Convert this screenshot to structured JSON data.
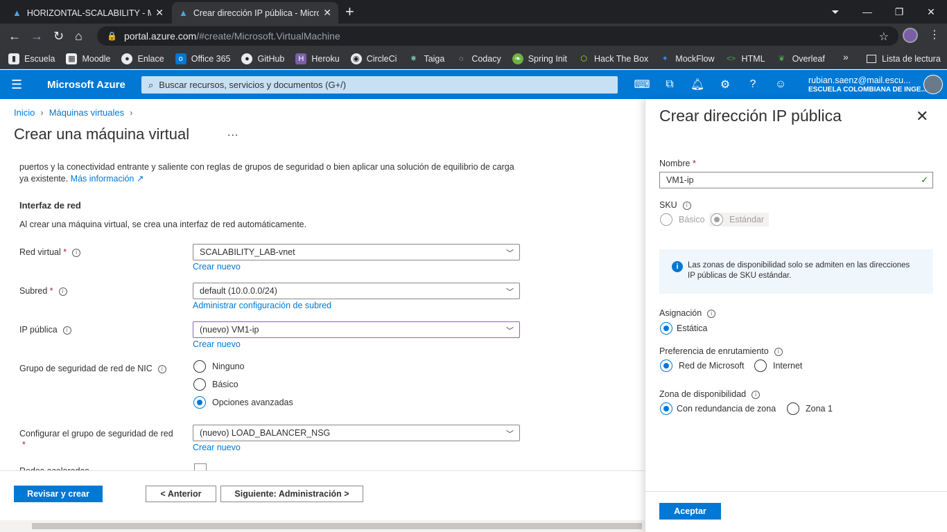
{
  "browser": {
    "tabs": [
      {
        "title": "HORIZONTAL-SCALABILITY - Mic",
        "active": false
      },
      {
        "title": "Crear dirección IP pública - Micro",
        "active": true
      }
    ],
    "url_host": "portal.azure.com",
    "url_path": "/#create/Microsoft.VirtualMachine",
    "bookmarks": [
      "Escuela",
      "Moodle",
      "Enlace",
      "Office 365",
      "GitHub",
      "Heroku",
      "CircleCi",
      "Taiga",
      "Codacy",
      "Spring Init",
      "Hack The Box",
      "MockFlow",
      "HTML",
      "Overleaf"
    ],
    "more": "»",
    "reading_list": "Lista de lectura"
  },
  "azure": {
    "brand": "Microsoft Azure",
    "search_placeholder": "Buscar recursos, servicios y documentos (G+/)",
    "account_email": "rubian.saenz@mail.escu...",
    "account_org": "ESCUELA COLOMBIANA DE INGE..."
  },
  "main": {
    "breadcrumb": [
      "Inicio",
      "Máquinas virtuales"
    ],
    "title": "Crear una máquina virtual",
    "title_more": "...",
    "description": "puertos y la conectividad entrante y saliente con reglas de grupos de seguridad o bien aplicar una solución de equilibrio de carga ya existente.",
    "more_info": "Más información",
    "section": "Interfaz de red",
    "section_desc": "Al crear una máquina virtual, se crea una interfaz de red automáticamente.",
    "fields": {
      "vnet_label": "Red virtual",
      "vnet_value": "SCALABILITY_LAB-vnet",
      "vnet_link": "Crear nuevo",
      "subnet_label": "Subred",
      "subnet_value": "default (10.0.0.0/24)",
      "subnet_link": "Administrar configuración de subred",
      "pip_label": "IP pública",
      "pip_value": "(nuevo) VM1-ip",
      "pip_link": "Crear nuevo",
      "nsg_label": "Grupo de seguridad de red de NIC",
      "nsg_options": [
        "Ninguno",
        "Básico",
        "Opciones avanzadas"
      ],
      "nsg_selected": "Opciones avanzadas",
      "nsg_cfg_label": "Configurar el grupo de seguridad de red",
      "nsg_cfg_value": "(nuevo) LOAD_BALANCER_NSG",
      "nsg_cfg_link": "Crear nuevo",
      "cutoff_label": "Redes aceleradas"
    },
    "buttons": {
      "review": "Revisar y crear",
      "previous": "< Anterior",
      "next": "Siguiente: Administración >"
    }
  },
  "panel": {
    "title": "Crear dirección IP pública",
    "name_label": "Nombre",
    "name_value": "VM1-ip",
    "sku_label": "SKU",
    "sku_options": [
      "Básico",
      "Estándar"
    ],
    "sku_selected": "Estándar",
    "info_text": "Las zonas de disponibilidad solo se admiten en las direcciones IP públicas de SKU estándar.",
    "assignment_label": "Asignación",
    "assignment_option": "Estática",
    "routing_label": "Preferencia de enrutamiento",
    "routing_options": [
      "Red de Microsoft",
      "Internet"
    ],
    "routing_selected": "Red de Microsoft",
    "zone_label": "Zona de disponibilidad",
    "zone_options": [
      "Con redundancia de zona",
      "Zona 1"
    ],
    "zone_selected": "Con redundancia de zona",
    "accept": "Aceptar"
  },
  "colors": {
    "azure_blue": "#0078d4",
    "required": "#a4262c",
    "chrome_dark": "#202124"
  }
}
